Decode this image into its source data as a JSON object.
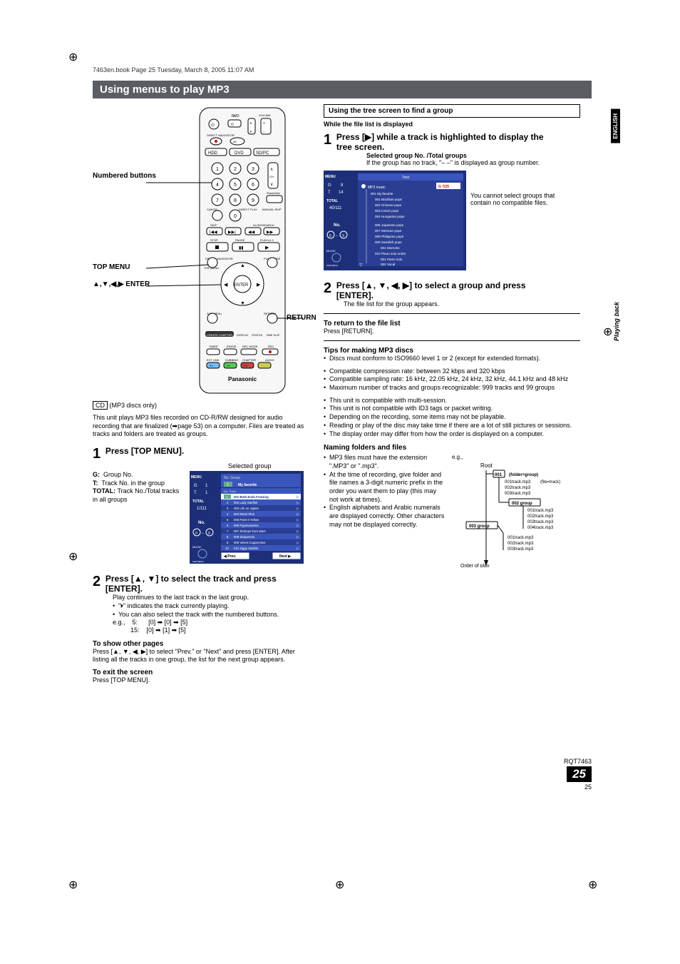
{
  "header": {
    "book_line": "7463en.book  Page 25  Tuesday, March 8, 2005  11:07 AM"
  },
  "title": "Using menus to play MP3",
  "side": {
    "english": "ENGLISH",
    "playing_back": "Playing back"
  },
  "remote_labels": {
    "numbered": "Numbered buttons",
    "top_menu": "TOP MENU",
    "arrows_enter": "▲,▼,◀,▶ ENTER",
    "return": "RETURN",
    "dvd": "DVD",
    "tv": "TV",
    "volume": "VOLUME",
    "directnav": "DIRECT NAVIGATOR",
    "av": "AV",
    "hdd": "HDD",
    "dvd_btn": "DVD",
    "sdpc": "SD/PC",
    "ch": "CH",
    "showview": "ShowView",
    "cancel": "CANCEL",
    "direct_play": "DIRECT PLAY",
    "manual_skip": "MANUAL SKIP",
    "skip": "SKIP",
    "slow_search": "SLOW/SEARCH",
    "stop": "STOP",
    "pause": "PAUSE",
    "play": "PLAY/x1.3",
    "direct_navigator": "DIRECT NAVIGATOR",
    "functions": "FUNCTIONS",
    "enter": "ENTER",
    "sub_menu": "SUB MENU",
    "return_btn": "RETURN",
    "create_chapter": "CREATE CHAPTER",
    "display": "DISPLAY",
    "status": "STATUS",
    "time_slip": "TIME SLIP",
    "timer": "TIMER",
    "erase": "ERASE",
    "rec_mode": "REC MODE",
    "rec": "REC",
    "ext_link": "EXT LINK",
    "dubbing": "DUBBING",
    "chapter": "CHAPTER",
    "audio": "AUDIO",
    "f1": "F1",
    "f2": "F2",
    "f3": "F3",
    "brand": "Panasonic"
  },
  "left": {
    "cd_label": "CD",
    "cd_note": " (MP3 discs only)",
    "intro": "This unit plays MP3 files recorded on CD-R/RW designed for audio recording that are finalized (➡page 53) on a computer. Files are treated as tracks and folders are treated as groups.",
    "step1": "Press [TOP MENU].",
    "selected_group": "Selected group",
    "legend": {
      "g": "G:",
      "g_txt": "Group No.",
      "t": "T:",
      "t_txt": "Track No. in the group",
      "total": "TOTAL:",
      "total_txt": "Track No./Total tracks in all groups"
    },
    "file_list": {
      "menu": "MENU",
      "g": "G",
      "t": "T",
      "g_val": "1",
      "t_val": "1",
      "total_lbl": "TOTAL",
      "total_val": "1/111",
      "no": "No.",
      "group_hdr": "No.      Group",
      "group_name": "My favorite",
      "track_hdr": "No.      Track",
      "tracks": [
        {
          "n": "1",
          "t": "001 Both Ends Freezing"
        },
        {
          "n": "2",
          "t": "002 Lady Starfish"
        },
        {
          "n": "3",
          "t": "003 Life on Jupiter"
        },
        {
          "n": "4",
          "t": "004 Metal Glue"
        },
        {
          "n": "5",
          "t": "005 Paint It Yellow"
        },
        {
          "n": "6",
          "t": "006 Pyjamamama"
        },
        {
          "n": "7",
          "t": "007 Shrimps from Mars"
        },
        {
          "n": "8",
          "t": "008 Starperson"
        },
        {
          "n": "9",
          "t": "009 Velvet Cuppermine"
        },
        {
          "n": "10",
          "t": "010 Ziggy Starfish"
        }
      ],
      "prev": "◀ Prev.",
      "next": "Next ▶",
      "music": "MUSIC",
      "submenu": "SUB MENU"
    },
    "step2": "Press [▲, ▼] to select the track and press [ENTER].",
    "step2_sub1": "Play continues to the last track in the last group.",
    "step2_b1": "\"🞂\" indicates the track currently playing.",
    "step2_b2": "You can also select the track with the numbered buttons.",
    "eg_label": "e.g.,",
    "eg5_k": "5:",
    "eg5_v": "[0] ➡ [0] ➡ [5]",
    "eg15_k": "15:",
    "eg15_v": "[0] ➡ [1] ➡ [5]",
    "to_show_other": "To show other pages",
    "to_show_other_txt": "Press [▲, ▼, ◀, ▶] to select \"Prev.\" or \"Next\" and press [ENTER]. After listing all the tracks in one group, the list for the next group appears.",
    "to_exit": "To exit the screen",
    "to_exit_txt": "Press [TOP MENU]."
  },
  "right": {
    "box_title": "Using the tree screen to find a group",
    "while_displayed": "While the file list is displayed",
    "step1": "Press [▶] while a track is highlighted to display the tree screen.",
    "sel_group": "Selected group No. /Total groups",
    "sel_group_note": "If the group has no track, \"– –\" is displayed as group number.",
    "tree": {
      "menu": "MENU",
      "g": "G",
      "t": "T",
      "g_val": "8",
      "t_val": "14",
      "total_lbl": "TOTAL",
      "total_val": "40/111",
      "tree_hdr": "Tree",
      "root": "MP3 music",
      "counter": "G  7/25",
      "items": [
        "001 My favorite",
        " 001 Brazilian pops",
        " 002 Chinese pops",
        " 003 Czech pops",
        " 004 Hungarian pops",
        "",
        " 005 Japanese pops",
        " 007 Mexican pops",
        " 008 Philippine pops",
        " 009 Swedish pops",
        "  001 Momoko",
        " 010 Piano solo under",
        "  001 Piano solo",
        "  002 Vocal"
      ],
      "no": "No.",
      "music": "MUSIC",
      "submenu": "SUB MENU"
    },
    "tree_note": "You cannot select groups that contain no compatible files.",
    "step2": "Press [▲, ▼, ◀, ▶] to select a group and press [ENTER].",
    "step2_sub": "The file list for the group appears.",
    "return_title": "To return to the file list",
    "return_txt": "Press [RETURN].",
    "tips_title": "Tips for making MP3 discs",
    "tips": [
      "Discs must conform to ISO9660 level 1 or 2 (except for extended formats).",
      "Compatible compression rate:  between 32 kbps and 320 kbps",
      "Compatible sampling rate: 16 kHz, 22.05 kHz, 24 kHz, 32 kHz, 44.1 kHz and 48 kHz",
      "Maximum number of tracks and groups recognizable: 999 tracks and 99 groups",
      "This unit is compatible with multi-session.",
      "This unit is not compatible with ID3 tags or packet writing.",
      "Depending on the recording, some items may not be playable.",
      "Reading or play of the disc may take time if there are a lot of still pictures or sessions.",
      "The display order may differ from how the order is displayed on a computer."
    ],
    "naming_title": "Naming folders and files",
    "naming": [
      "MP3 files must have the extension \".MP3\" or \".mp3\".",
      "At the time of recording, give folder and file names a 3-digit numeric prefix in the order you want them to play (this may not work at times).",
      "English alphabets and Arabic numerals are displayed correctly. Other characters may not be displayed correctly."
    ],
    "eg": "e.g.,",
    "folder_tree": {
      "root": "Root",
      "n001": "001",
      "fg": "(folder=group)",
      "t1": "001track.mp3",
      "ft": "(file=track)",
      "t2": "002track.mp3",
      "t3": "003track.mp3",
      "n002": "002 group",
      "g2_t1": "001track.mp3",
      "g2_t2": "002track.mp3",
      "g2_t3": "003track.mp3",
      "g2_t4": "004track.mp3",
      "n003": "003 group",
      "g3_t1": "001track.mp3",
      "g3_t2": "002track.mp3",
      "g3_t3": "003track.mp3",
      "order": "Order of play"
    }
  },
  "footer": {
    "rqt": "RQT7463",
    "page_big": "25",
    "page_small": "25"
  }
}
